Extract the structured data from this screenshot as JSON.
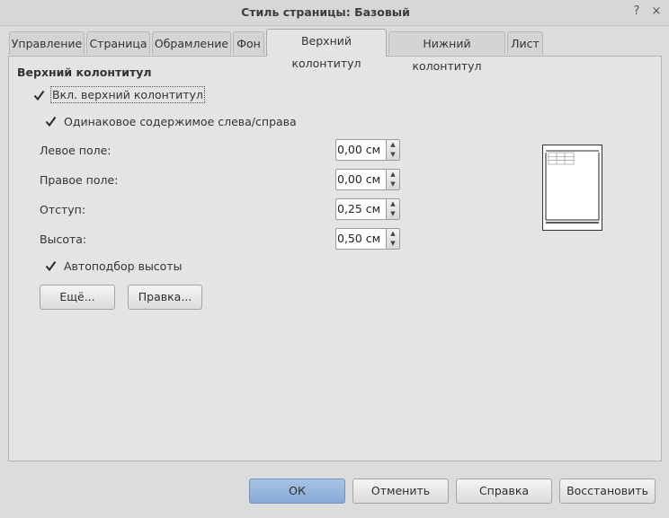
{
  "window": {
    "title": "Стиль страницы: Базовый",
    "controls": {
      "help": "?",
      "close": "×"
    }
  },
  "tabs": [
    {
      "label": "Управление"
    },
    {
      "label": "Страница"
    },
    {
      "label": "Обрамление"
    },
    {
      "label": "Фон"
    },
    {
      "label": "Верхний колонтитул",
      "active": true
    },
    {
      "label": "Нижний колонтитул"
    },
    {
      "label": "Лист"
    }
  ],
  "header_section": {
    "title": "Верхний колонтитул",
    "enable_header": {
      "label": "Вкл. верхний колонтитул",
      "checked": true
    },
    "same_content": {
      "label": "Одинаковое содержимое слева/справа",
      "checked": true
    },
    "left_margin": {
      "label": "Левое поле:",
      "value": "0,00 см"
    },
    "right_margin": {
      "label": "Правое поле:",
      "value": "0,00 см"
    },
    "spacing": {
      "label": "Отступ:",
      "value": "0,25 см"
    },
    "height": {
      "label": "Высота:",
      "value": "0,50 см"
    },
    "autofit_height": {
      "label": "Автоподбор высоты",
      "checked": true
    },
    "more_button": "Ещё...",
    "edit_button": "Правка..."
  },
  "buttons": {
    "ok": "ОК",
    "cancel": "Отменить",
    "help": "Справка",
    "reset": "Восстановить"
  },
  "colors": {
    "dialog_bg": "#dcdcdc",
    "panel_bg": "#e4e4e4",
    "ok_button": "#94b4dc"
  }
}
